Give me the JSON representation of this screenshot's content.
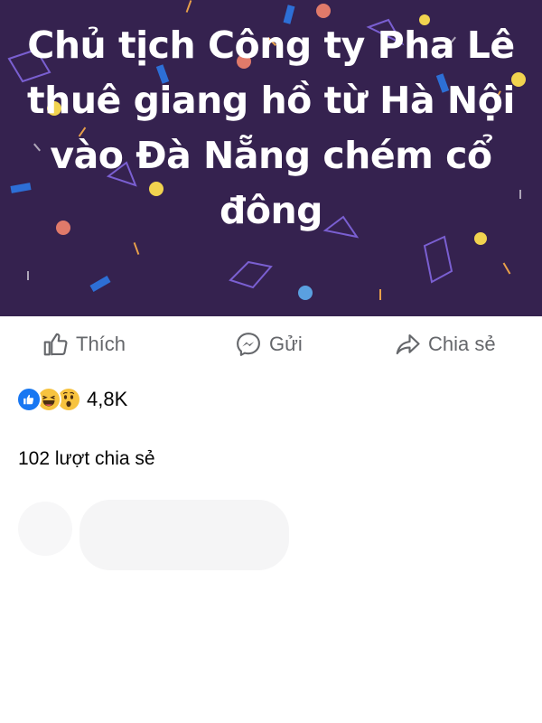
{
  "post": {
    "banner_text": "Chủ tịch Công ty Pha Lê thuê giang hồ từ Hà Nội vào Đà Nẵng chém cổ đông",
    "banner_bg": "#35224f"
  },
  "actions": {
    "like_label": "Thích",
    "send_label": "Gửi",
    "share_label": "Chia sẻ"
  },
  "reactions": {
    "icons": [
      "like-icon",
      "haha-icon",
      "wow-icon"
    ],
    "count": "4,8K"
  },
  "shares": {
    "text": "102 lượt chia sẻ"
  },
  "colors": {
    "action_text": "#65676b",
    "like_blue": "#1877f2",
    "emoji_yellow": "#f7c33f"
  }
}
